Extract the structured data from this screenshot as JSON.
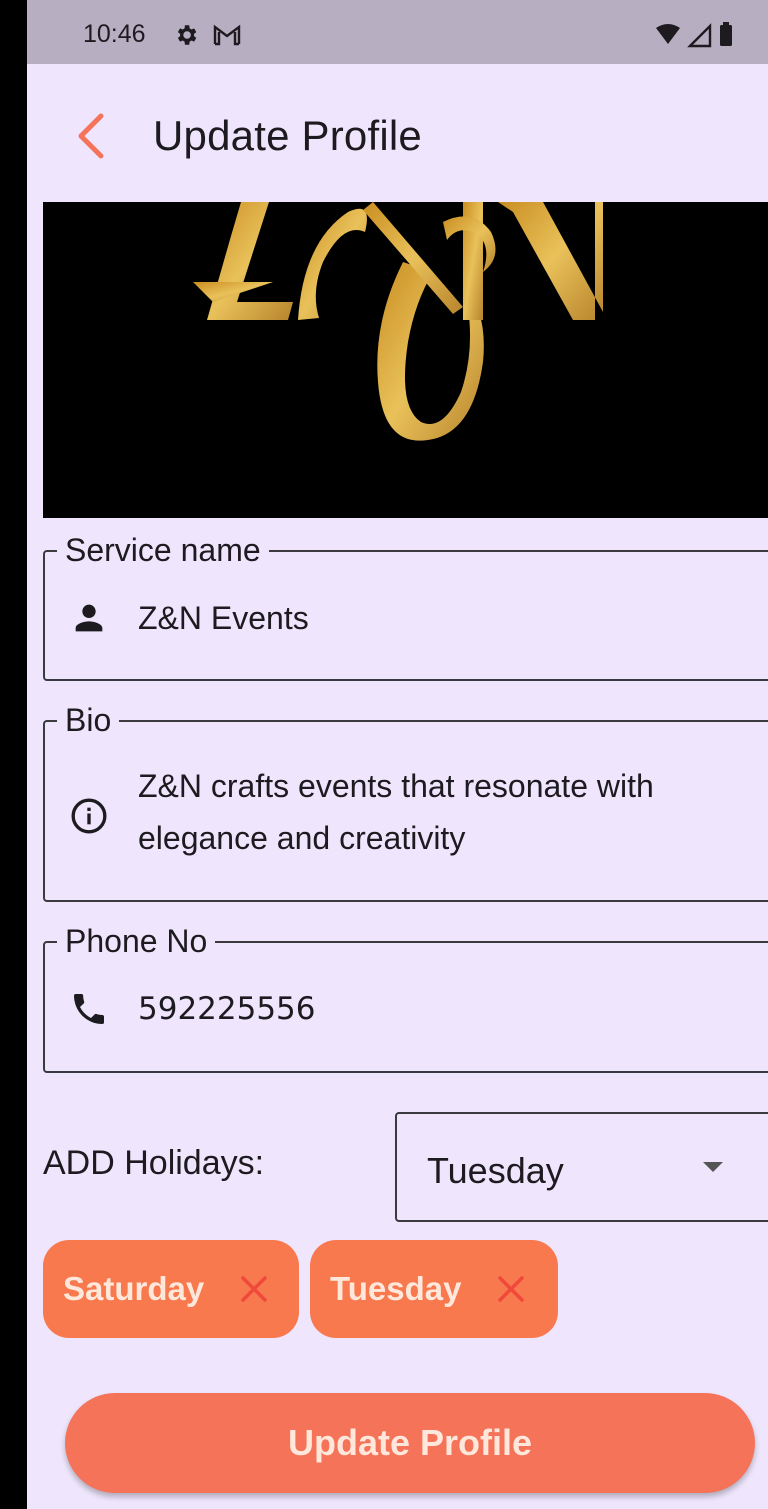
{
  "status_bar": {
    "time": "10:46",
    "icons": [
      "gear-icon",
      "gmail-icon",
      "wifi-icon",
      "signal-icon",
      "battery-icon"
    ]
  },
  "app_bar": {
    "title": "Update Profile",
    "back_icon": "chevron-left-icon"
  },
  "banner": {
    "logo_text": "Z&N",
    "colors": {
      "background": "#000000",
      "gold": "#D9A734"
    }
  },
  "form": {
    "service_name": {
      "label": "Service name",
      "value": "Z&N Events",
      "icon": "person-icon"
    },
    "bio": {
      "label": "Bio",
      "value_line1": "Z&N crafts events that resonate with",
      "value_line2": "elegance and creativity",
      "icon": "info-icon"
    },
    "phone": {
      "label": "Phone No",
      "value": "592225556",
      "icon": "phone-icon"
    }
  },
  "holidays": {
    "label": "ADD Holidays:",
    "selected": "Tuesday",
    "chips": [
      {
        "label": "Saturday"
      },
      {
        "label": "Tuesday"
      }
    ]
  },
  "actions": {
    "update_label": "Update Profile"
  },
  "colors": {
    "accent": "#F8794E",
    "button": "#F47359",
    "background": "#EFE6FD"
  }
}
